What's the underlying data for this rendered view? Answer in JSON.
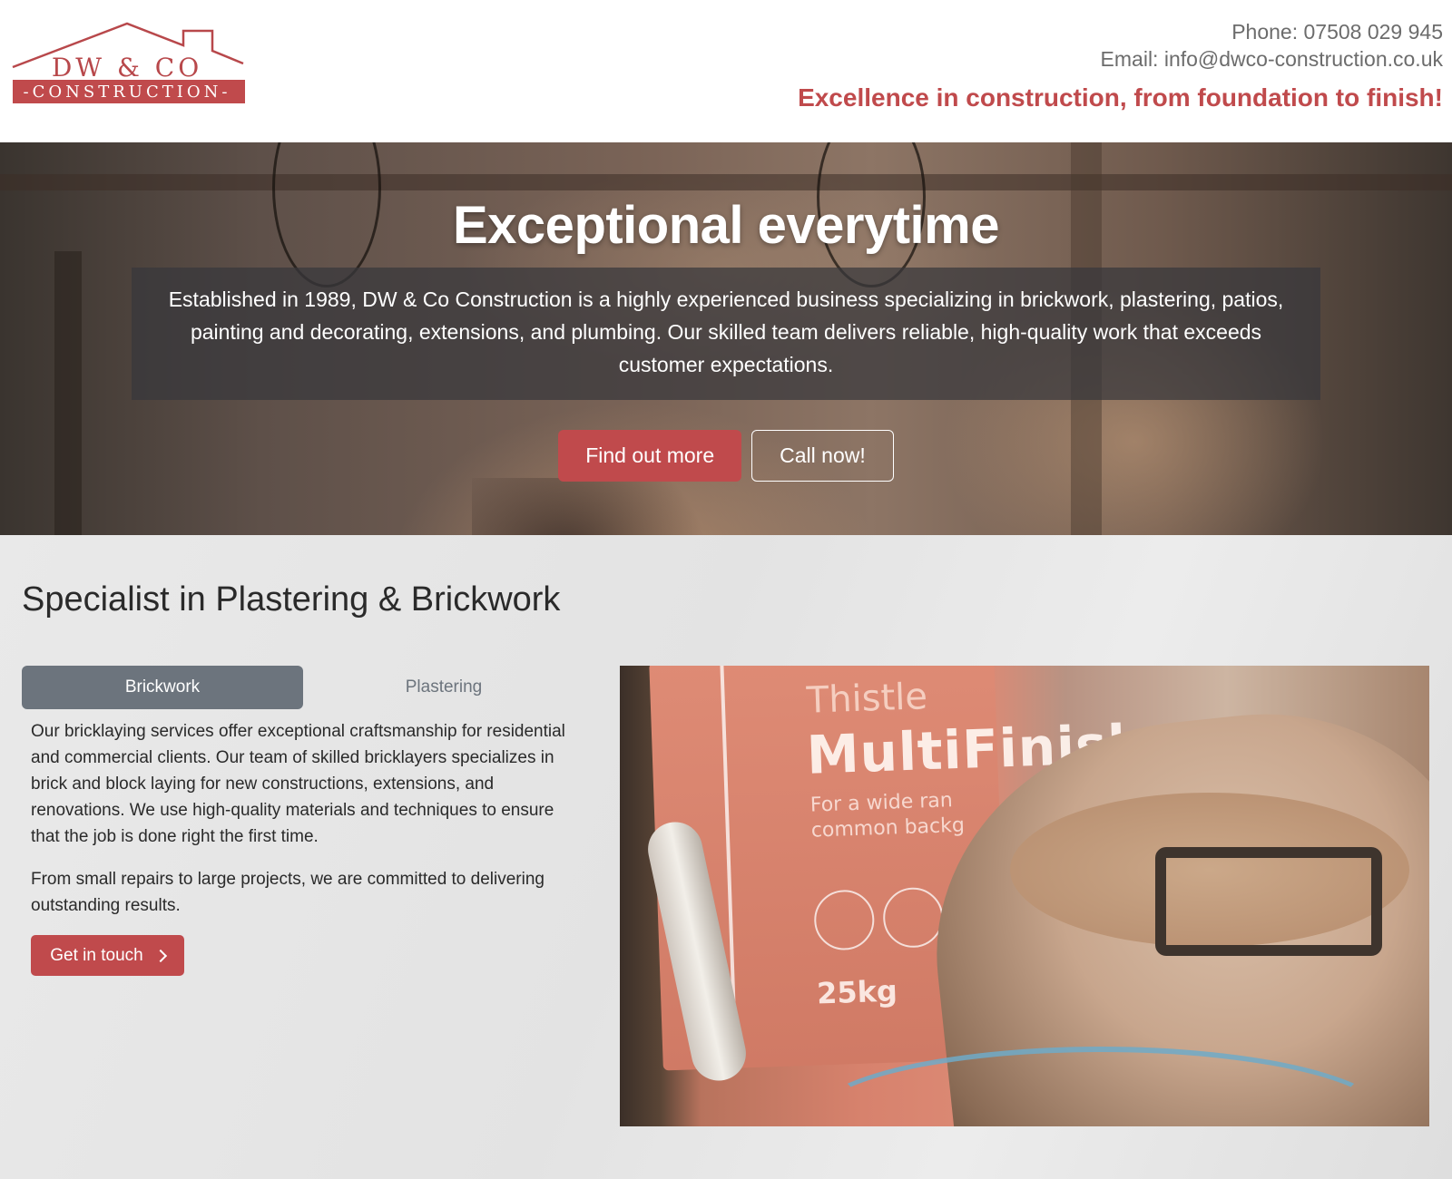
{
  "brand": {
    "logo_line1": "DW & CO",
    "logo_line2": "-CONSTRUCTION-",
    "accent_color": "#c04a4c"
  },
  "header": {
    "phone": "Phone: 07508 029 945",
    "email": "Email: info@dwco-construction.co.uk",
    "tagline": "Excellence in construction, from foundation to finish!"
  },
  "hero": {
    "title": "Exceptional everytime",
    "text": "Established in 1989, DW & Co Construction is a highly experienced business specializing in brickwork, plastering, patios, painting and decorating, extensions, and plumbing. Our skilled team delivers reliable, high-quality work that exceeds customer expectations.",
    "primary_button": "Find out more",
    "secondary_button": "Call now!"
  },
  "services": {
    "title": "Specialist in Plastering & Brickwork",
    "tabs": [
      {
        "label": "Brickwork",
        "active": true
      },
      {
        "label": "Plastering",
        "active": false
      }
    ],
    "paragraphs": [
      "Our bricklaying services offer exceptional craftsmanship for residential and commercial clients. Our team of skilled bricklayers specializes in brick and block laying for new constructions, extensions, and renovations. We use high-quality materials and techniques to ensure that the job is done right the first time.",
      "From small repairs to large projects, we are committed to delivering outstanding results."
    ],
    "cta_button": "Get in touch",
    "cta_icon": "chevron-right-icon"
  },
  "photo": {
    "bag_brand": "Thistle",
    "bag_name": "MultiFinish",
    "bag_subtitle_1": "For a wide ran",
    "bag_subtitle_2": "common backg",
    "bag_weight": "25kg"
  }
}
